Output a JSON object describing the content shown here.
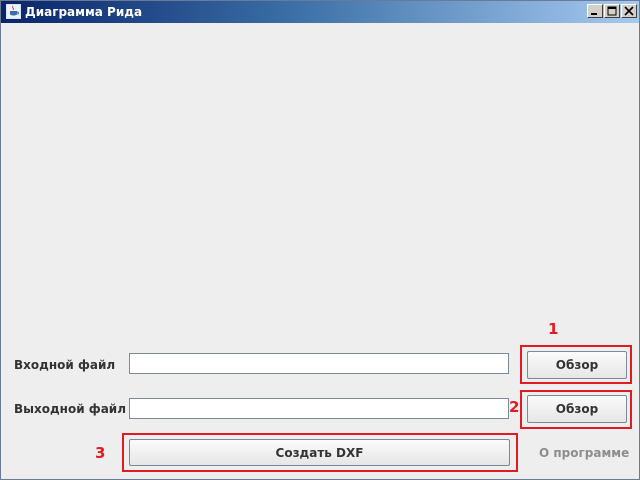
{
  "window": {
    "title": "Диаграмма Рида",
    "controls": [
      "minimize-icon",
      "maximize-icon",
      "close-icon"
    ],
    "app_icon": "java-cup-icon"
  },
  "input_row": {
    "label": "Входной файл",
    "value": "",
    "browse_label": "Обзор"
  },
  "output_row": {
    "label": "Выходной файл",
    "value": "",
    "browse_label": "Обзор"
  },
  "actions": {
    "create_label": "Создать DXF",
    "about_label": "О программе"
  },
  "annotations": {
    "one": "1",
    "two": "2",
    "three": "3"
  },
  "colors": {
    "annotation": "#e01b24",
    "window_bg": "#eeeeee",
    "titlebar_start": "#0a246a",
    "titlebar_end": "#a6caf0"
  }
}
